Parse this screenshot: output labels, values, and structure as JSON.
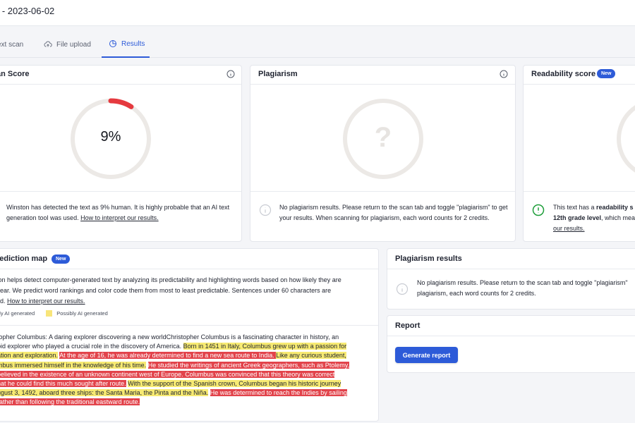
{
  "header": {
    "title": "d - 2023-06-02"
  },
  "tabs": [
    {
      "label": "ext scan",
      "icon": "text-icon"
    },
    {
      "label": "File upload",
      "icon": "cloud-upload-icon"
    },
    {
      "label": "Results",
      "icon": "pie-chart-icon"
    }
  ],
  "human_score": {
    "title": "an Score",
    "value": "9%",
    "percent": 9,
    "description": "Winston has detected the text as 9% human. It is highly probable that an AI text generation tool was used. ",
    "link": "How to interpret our results."
  },
  "plagiarism": {
    "title": "Plagiarism",
    "glyph": "?",
    "description": "No plagiarism results. Please return to the scan tab and toggle \"plagiarism\" to get your results. When scanning for plagiarism, each word counts for 2 credits."
  },
  "readability": {
    "title": "Readability score",
    "badge": "New",
    "line1_prefix": "This text has a ",
    "line1_bold": "readability s",
    "line2_bold": "12th grade level",
    "line2_rest": ", which mea",
    "link": "our results."
  },
  "prediction_map": {
    "title": "rediction map",
    "badge": "New",
    "line1": "ton helps detect computer-generated text by analyzing its predictability and highlighting words based on how likely they are",
    "line2": "pear. We predict word rankings and color code them from most to least predictable. Sentences under 60 characters are",
    "line3_prefix": "ed. ",
    "line3_link": "How to interpret our results.",
    "legend_likely": "ely AI generated",
    "legend_possibly": "Possibly AI generated",
    "text": [
      {
        "line": [
          "topher Columbus: A daring explorer discovering a new worldChristopher Columbus is a fascinating character in history, an"
        ]
      },
      {
        "parts": [
          {
            "t": "pid explorer who played a crucial role in the discovery of America. ",
            "h": ""
          },
          {
            "t": "Born in 1451 in Italy, Columbus grew up with a passion for",
            "h": "y"
          }
        ]
      },
      {
        "parts": [
          {
            "t": "ation and exploration.",
            "h": "y"
          },
          {
            "t": " ",
            "h": ""
          },
          {
            "t": " At the age of 16, he was already determined to find a new sea route to India. ",
            "h": "r"
          },
          {
            "t": " ",
            "h": ""
          },
          {
            "t": "Like any curious student,",
            "h": "y"
          }
        ]
      },
      {
        "parts": [
          {
            "t": "mbus immersed himself in the knowledge of his time.",
            "h": "y"
          },
          {
            "t": " ",
            "h": ""
          },
          {
            "t": " He studied the writings of ancient Greek geographers, such as Ptolemy,",
            "h": "r"
          }
        ]
      },
      {
        "parts": [
          {
            "t": "believed in the existence of an unknown continent west of Europe. ",
            "h": "r"
          },
          {
            "t": "  ",
            "h": ""
          },
          {
            "t": "Columbus was convinced that this theory was correct",
            "h": "r"
          }
        ]
      },
      {
        "parts": [
          {
            "t": "hat he could find this much sought after route.",
            "h": "r"
          },
          {
            "t": " ",
            "h": ""
          },
          {
            "t": "With the support of the Spanish crown, Columbus began his historic journey",
            "h": "y"
          }
        ]
      },
      {
        "parts": [
          {
            "t": "ugust 3, 1492, aboard three ships: the Santa Maria, the Pinta and the Niña.",
            "h": "y"
          },
          {
            "t": " ",
            "h": ""
          },
          {
            "t": " He was determined to reach the Indies by sailing",
            "h": "r"
          }
        ]
      },
      {
        "parts": [
          {
            "t": "rather than following the traditional eastward route.",
            "h": "r"
          }
        ]
      }
    ]
  },
  "plagiarism_results": {
    "title": "Plagiarism results",
    "line1": "No plagiarism results. Please return to the scan tab and toggle \"plagiarism\"",
    "line2": "plagiarism, each word counts for 2 credits."
  },
  "report": {
    "title": "Report",
    "button": "Generate report"
  },
  "colors": {
    "accent": "#2d5bd8",
    "score_arc": "#e53a3f",
    "ring": "#ece9e6",
    "highlight_yellow": "#f7ea72",
    "highlight_red": "#e2434b",
    "success": "#1e9e3a"
  }
}
